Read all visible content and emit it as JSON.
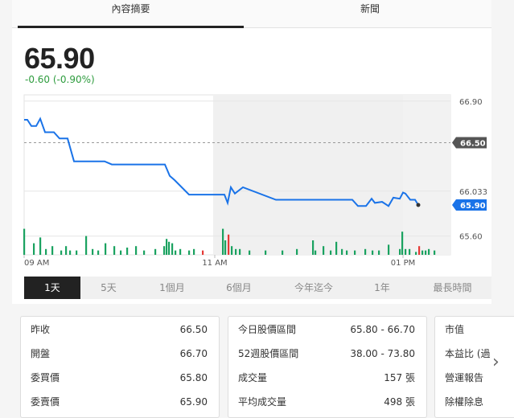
{
  "tabs": [
    {
      "label": "內容摘要",
      "active": true
    },
    {
      "label": "新聞",
      "active": false
    }
  ],
  "quote": {
    "price": "65.90",
    "change": "-0.60 (-0.90%)",
    "change_color": "#2e9c3e"
  },
  "chart_data": {
    "type": "line",
    "y_tick_labels": [
      "66.90",
      "66.033",
      "65.60"
    ],
    "x_tick_labels": [
      "09 AM",
      "11 AM",
      "01 PM"
    ],
    "ylim": [
      65.42,
      66.96
    ],
    "previous_close_label": "66.50",
    "previous_close": 66.5,
    "current_price_label": "65.90",
    "current_price": 65.9,
    "line_color": "#1a73e8",
    "series": [
      {
        "points": [
          [
            0,
            66.72
          ],
          [
            4,
            66.72
          ],
          [
            9,
            66.66
          ],
          [
            15,
            66.66
          ],
          [
            20,
            66.73
          ],
          [
            26,
            66.6
          ],
          [
            37,
            66.6
          ],
          [
            44,
            66.54
          ],
          [
            54,
            66.54
          ],
          [
            62,
            66.32
          ],
          [
            100,
            66.32
          ],
          [
            109,
            66.29
          ],
          [
            175,
            66.29
          ],
          [
            181,
            66.18
          ],
          [
            187,
            66.14
          ],
          [
            205,
            66.0
          ],
          [
            249,
            66.0
          ],
          [
            253,
            65.92
          ],
          [
            257,
            66.07
          ],
          [
            262,
            66.01
          ],
          [
            272,
            66.07
          ],
          [
            313,
            65.95
          ],
          [
            322,
            65.95
          ],
          [
            408,
            65.95
          ],
          [
            415,
            65.89
          ],
          [
            425,
            65.89
          ],
          [
            432,
            65.96
          ],
          [
            436,
            65.92
          ],
          [
            445,
            65.93
          ],
          [
            453,
            65.89
          ],
          [
            459,
            65.97
          ],
          [
            467,
            65.96
          ],
          [
            471,
            66.02
          ],
          [
            474,
            66.01
          ],
          [
            480,
            65.95
          ],
          [
            486,
            65.95
          ],
          [
            490,
            65.9
          ]
        ]
      }
    ],
    "volume_bars": [
      {
        "x": 0,
        "v": 0.9,
        "c": "g"
      },
      {
        "x": 12,
        "v": 0.4,
        "c": "g"
      },
      {
        "x": 20,
        "v": 0.6,
        "c": "g"
      },
      {
        "x": 27,
        "v": 0.2,
        "c": "g"
      },
      {
        "x": 35,
        "v": 0.3,
        "c": "g"
      },
      {
        "x": 46,
        "v": 0.15,
        "c": "g"
      },
      {
        "x": 52,
        "v": 0.3,
        "c": "g"
      },
      {
        "x": 57,
        "v": 0.15,
        "c": "g"
      },
      {
        "x": 65,
        "v": 0.15,
        "c": "g"
      },
      {
        "x": 77,
        "v": 0.65,
        "c": "g"
      },
      {
        "x": 85,
        "v": 0.2,
        "c": "g"
      },
      {
        "x": 92,
        "v": 0.15,
        "c": "g"
      },
      {
        "x": 101,
        "v": 0.4,
        "c": "g"
      },
      {
        "x": 112,
        "v": 0.3,
        "c": "g"
      },
      {
        "x": 120,
        "v": 0.15,
        "c": "g"
      },
      {
        "x": 128,
        "v": 0.25,
        "c": "g"
      },
      {
        "x": 139,
        "v": 0.3,
        "c": "g"
      },
      {
        "x": 149,
        "v": 0.15,
        "c": "g"
      },
      {
        "x": 163,
        "v": 0.2,
        "c": "g"
      },
      {
        "x": 174,
        "v": 0.3,
        "c": "g"
      },
      {
        "x": 177,
        "v": 0.55,
        "c": "g"
      },
      {
        "x": 180,
        "v": 0.45,
        "c": "g"
      },
      {
        "x": 184,
        "v": 0.4,
        "c": "g"
      },
      {
        "x": 188,
        "v": 0.15,
        "c": "g"
      },
      {
        "x": 194,
        "v": 0.2,
        "c": "g"
      },
      {
        "x": 205,
        "v": 0.15,
        "c": "g"
      },
      {
        "x": 211,
        "v": 0.2,
        "c": "g"
      },
      {
        "x": 222,
        "v": 0.15,
        "c": "r"
      },
      {
        "x": 247,
        "v": 0.9,
        "c": "g"
      },
      {
        "x": 250,
        "v": 0.5,
        "c": "g"
      },
      {
        "x": 254,
        "v": 0.7,
        "c": "r"
      },
      {
        "x": 258,
        "v": 0.3,
        "c": "g"
      },
      {
        "x": 263,
        "v": 0.2,
        "c": "g"
      },
      {
        "x": 268,
        "v": 0.2,
        "c": "g"
      },
      {
        "x": 280,
        "v": 0.15,
        "c": "g"
      },
      {
        "x": 300,
        "v": 0.15,
        "c": "g"
      },
      {
        "x": 321,
        "v": 0.15,
        "c": "g"
      },
      {
        "x": 339,
        "v": 0.2,
        "c": "g"
      },
      {
        "x": 359,
        "v": 0.5,
        "c": "g"
      },
      {
        "x": 362,
        "v": 0.15,
        "c": "g"
      },
      {
        "x": 372,
        "v": 0.3,
        "c": "g"
      },
      {
        "x": 381,
        "v": 0.15,
        "c": "g"
      },
      {
        "x": 388,
        "v": 0.45,
        "c": "g"
      },
      {
        "x": 395,
        "v": 0.2,
        "c": "g"
      },
      {
        "x": 401,
        "v": 0.15,
        "c": "g"
      },
      {
        "x": 411,
        "v": 0.15,
        "c": "g"
      },
      {
        "x": 424,
        "v": 0.2,
        "c": "g"
      },
      {
        "x": 433,
        "v": 0.15,
        "c": "g"
      },
      {
        "x": 441,
        "v": 0.15,
        "c": "g"
      },
      {
        "x": 453,
        "v": 0.35,
        "c": "g"
      },
      {
        "x": 467,
        "v": 0.2,
        "c": "g"
      },
      {
        "x": 470,
        "v": 0.8,
        "c": "g"
      },
      {
        "x": 474,
        "v": 0.2,
        "c": "g"
      },
      {
        "x": 479,
        "v": 0.2,
        "c": "g"
      },
      {
        "x": 487,
        "v": 0.1,
        "c": "g"
      },
      {
        "x": 491,
        "v": 0.3,
        "c": "r"
      },
      {
        "x": 495,
        "v": 0.15,
        "c": "g"
      },
      {
        "x": 499,
        "v": 0.15,
        "c": "g"
      },
      {
        "x": 503,
        "v": 0.2,
        "c": "g"
      },
      {
        "x": 510,
        "v": 0.15,
        "c": "g"
      }
    ],
    "colors": {
      "up": "#1aa260",
      "down": "#e53935",
      "grid": "#e6e6e6",
      "shade": "#f0f0f0"
    }
  },
  "ranges": [
    {
      "label": "1天",
      "active": true
    },
    {
      "label": "5天",
      "active": false
    },
    {
      "label": "1個月",
      "active": false
    },
    {
      "label": "6個月",
      "active": false
    },
    {
      "label": "今年迄今",
      "active": false
    },
    {
      "label": "1年",
      "active": false
    },
    {
      "label": "最長時間",
      "active": false
    }
  ],
  "stats": {
    "box1": [
      {
        "label": "昨收",
        "value": "66.50"
      },
      {
        "label": "開盤",
        "value": "66.70"
      },
      {
        "label": "委買價",
        "value": "65.80"
      },
      {
        "label": "委賣價",
        "value": "65.90"
      }
    ],
    "box2": [
      {
        "label": "今日股價區間",
        "value": "65.80 - 66.70"
      },
      {
        "label": "52週股價區間",
        "value": "38.00 - 73.80"
      },
      {
        "label": "成交量",
        "value": "157 張"
      },
      {
        "label": "平均成交量",
        "value": "498 張"
      }
    ],
    "box3": [
      {
        "label": "市值"
      },
      {
        "label": "本益比 (過"
      },
      {
        "label": "營運報告"
      },
      {
        "label": "除權除息"
      }
    ]
  },
  "icons": {
    "next": "chevron-right-icon",
    "next_glyph": "›"
  }
}
